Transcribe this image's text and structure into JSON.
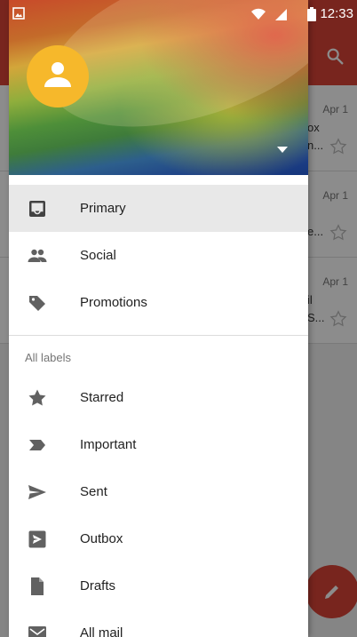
{
  "status_bar": {
    "time": "12:33"
  },
  "drawer": {
    "primary_items": [
      {
        "label": "Primary",
        "icon": "inbox-icon",
        "selected": true
      },
      {
        "label": "Social",
        "icon": "people-icon"
      },
      {
        "label": "Promotions",
        "icon": "tag-icon"
      }
    ],
    "section_label": "All labels",
    "label_items": [
      {
        "label": "Starred",
        "icon": "star-icon"
      },
      {
        "label": "Important",
        "icon": "important-icon"
      },
      {
        "label": "Sent",
        "icon": "send-icon"
      },
      {
        "label": "Outbox",
        "icon": "outbox-icon"
      },
      {
        "label": "Drafts",
        "icon": "draft-icon"
      },
      {
        "label": "All mail",
        "icon": "mail-icon"
      }
    ]
  },
  "inbox_behind": {
    "rows": [
      {
        "date": "Apr 1",
        "line1": "ox",
        "line2": "n..."
      },
      {
        "date": "Apr 1",
        "line1": "",
        "line2": "e..."
      },
      {
        "date": "Apr 1",
        "line1": "il",
        "line2": "S..."
      }
    ]
  },
  "colors": {
    "accent": "#db4437",
    "avatar": "#f6b82b",
    "selected_bg": "#e8e8e8",
    "icon": "#616161"
  }
}
